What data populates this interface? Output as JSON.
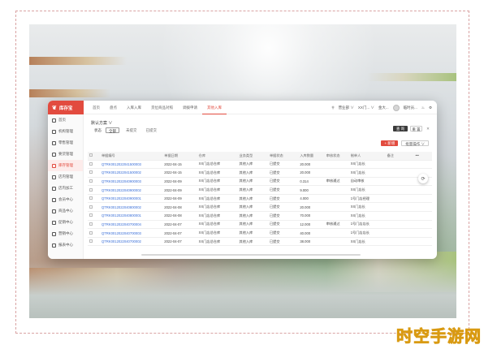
{
  "app": {
    "logo_mark": "❦",
    "logo_name": "库存宝"
  },
  "topbar": {
    "tabs": [
      "首页",
      "盘点",
      "入库入库",
      "货位商品对照",
      "调拨申请",
      "其他入库"
    ],
    "active_tab": 5,
    "store": "营业部 ∨",
    "branch": "XX门... ∨",
    "user": "金大...",
    "account": "临时员..."
  },
  "sidebar": {
    "items": [
      {
        "label": "首页",
        "icon": "home-icon"
      },
      {
        "label": "机构管理",
        "icon": "org-icon"
      },
      {
        "label": "零售管理",
        "icon": "retail-icon"
      },
      {
        "label": "要货管理",
        "icon": "order-icon"
      },
      {
        "label": "库存管理",
        "icon": "stock-icon"
      },
      {
        "label": "店内管理",
        "icon": "store-icon"
      },
      {
        "label": "店内加工",
        "icon": "process-icon"
      },
      {
        "label": "会员中心",
        "icon": "member-icon"
      },
      {
        "label": "商品中心",
        "icon": "goods-icon"
      },
      {
        "label": "促销中心",
        "icon": "promo-icon"
      },
      {
        "label": "营销中心",
        "icon": "marketing-icon"
      },
      {
        "label": "报表中心",
        "icon": "report-icon"
      }
    ],
    "active_index": 4
  },
  "filter": {
    "title": "默认方案 ∨",
    "status_label": "状态",
    "options": [
      "全部",
      "未提交",
      "已提交"
    ],
    "selected": 0,
    "search_label": "查 询",
    "reset_label": "重 置",
    "close_label": "✕"
  },
  "actions": {
    "new_label": "+ 新增",
    "batch_label": "批量操作 ∨"
  },
  "table": {
    "headers": [
      "",
      "单据编号",
      "单据日期",
      "仓库",
      "业务类型",
      "单据状态",
      "入库数量",
      "审核状态",
      "制单人",
      "备注",
      "•••"
    ],
    "rows": [
      [
        "",
        "QTRK0012022041500003",
        "2022-04-15",
        "XX门店总仓库",
        "其他入库",
        "已提交",
        "20.000",
        "",
        "XX门店长",
        "",
        ""
      ],
      [
        "",
        "QTRK0012022041500002",
        "2022-04-15",
        "XX门店总仓库",
        "其他入库",
        "已提交",
        "20.000",
        "",
        "XX门店长",
        "",
        ""
      ],
      [
        "",
        "QTRK0012022040900003",
        "2022-04-09",
        "XX门店总仓库",
        "其他入库",
        "已提交",
        "0.314",
        "审核通过",
        "自动审核",
        "",
        ""
      ],
      [
        "",
        "QTRK0012022040900002",
        "2022-04-09",
        "XX门店总仓库",
        "其他入库",
        "已提交",
        "9.000",
        "",
        "XX门店长",
        "",
        ""
      ],
      [
        "",
        "QTRK0012022040900001",
        "2022-04-09",
        "XX门店总仓库",
        "其他入库",
        "已提交",
        "4.000",
        "",
        "1号门店经理",
        "",
        ""
      ],
      [
        "",
        "QTRK0012022040800002",
        "2022-04-08",
        "XX门店总仓库",
        "其他入库",
        "已提交",
        "20.000",
        "",
        "XX门店长",
        "",
        ""
      ],
      [
        "",
        "QTRK0012022040800001",
        "2022-04-08",
        "XX门店总仓库",
        "其他入库",
        "已提交",
        "70.000",
        "",
        "XX门店长",
        "",
        ""
      ],
      [
        "",
        "QTRK0012022040700004",
        "2022-04-07",
        "XX门店总仓库",
        "其他入库",
        "已提交",
        "12.000",
        "审核通过",
        "1号门店店长",
        "",
        ""
      ],
      [
        "",
        "QTRK0012022040700003",
        "2022-04-07",
        "XX门店总仓库",
        "其他入库",
        "已提交",
        "40.000",
        "",
        "1号门店店长",
        "",
        ""
      ],
      [
        "",
        "QTRK0012022040700002",
        "2022-04-07",
        "XX门店总仓库",
        "其他入库",
        "已提交",
        "38.000",
        "",
        "XX门店长",
        "",
        ""
      ]
    ]
  },
  "colors": {
    "accent": "#e24b3f",
    "link": "#3a6fd8"
  },
  "watermark": "时空手游网"
}
